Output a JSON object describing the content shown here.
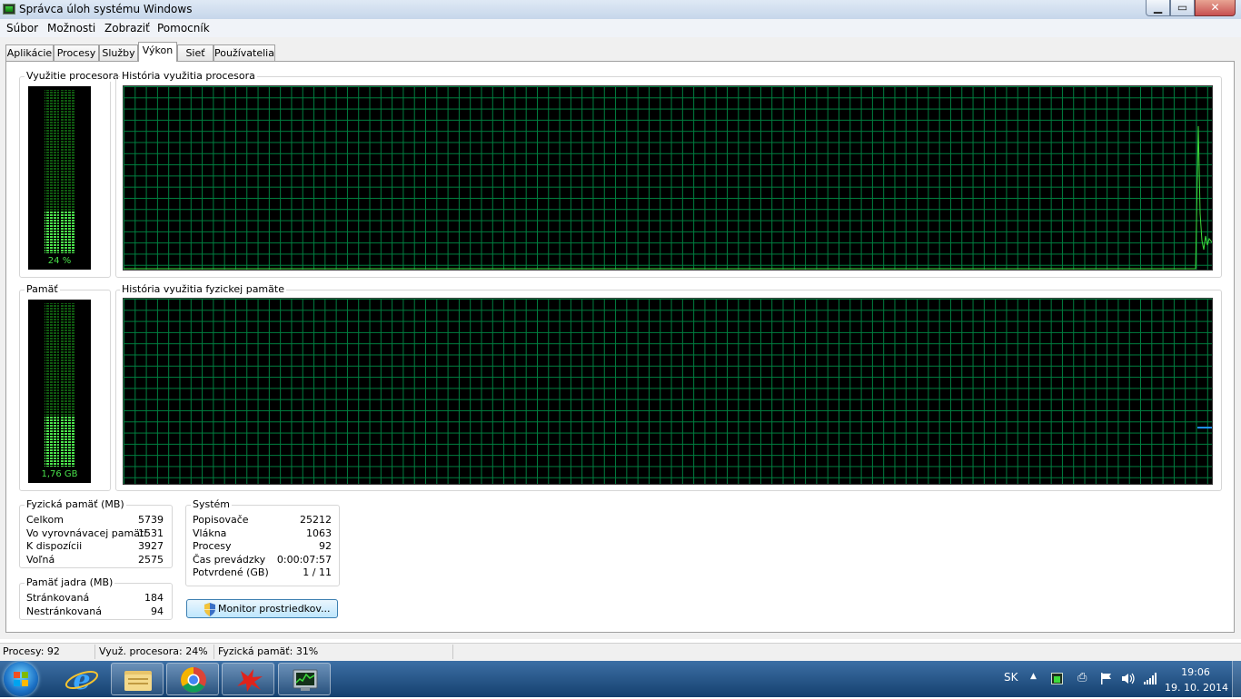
{
  "window": {
    "title": "Správca úloh systému Windows"
  },
  "caption_buttons": {
    "minimize": "▁",
    "maximize": "▭",
    "close": "✕"
  },
  "menu": [
    "Súbor",
    "Možnosti",
    "Zobraziť",
    "Pomocník"
  ],
  "tabs": [
    "Aplikácie",
    "Procesy",
    "Služby",
    "Výkon",
    "Sieť",
    "Používatelia"
  ],
  "active_tab": "Výkon",
  "cpu": {
    "gauge_label": "Využitie procesora",
    "gauge_value": "24 %",
    "history_label": "História využitia procesora"
  },
  "memory": {
    "gauge_label": "Pamäť",
    "gauge_value": "1,76 GB",
    "history_label": "História využitia fyzickej pamäte"
  },
  "physical_memory": {
    "title": "Fyzická pamäť (MB)",
    "rows": [
      {
        "label": "Celkom",
        "value": "5739"
      },
      {
        "label": "Vo vyrovnávacej pamäti",
        "value": "1531"
      },
      {
        "label": "K dispozícii",
        "value": "3927"
      },
      {
        "label": "Voľná",
        "value": "2575"
      }
    ]
  },
  "kernel_memory": {
    "title": "Pamäť jadra (MB)",
    "rows": [
      {
        "label": "Stránkovaná",
        "value": "184"
      },
      {
        "label": "Nestránkovaná",
        "value": "94"
      }
    ]
  },
  "system": {
    "title": "Systém",
    "rows": [
      {
        "label": "Popisovače",
        "value": "25212"
      },
      {
        "label": "Vlákna",
        "value": "1063"
      },
      {
        "label": "Procesy",
        "value": "92"
      },
      {
        "label": "Čas prevádzky",
        "value": "0:00:07:57"
      },
      {
        "label": "Potvrdené (GB)",
        "value": "1 / 11"
      }
    ]
  },
  "resource_monitor_button": "Monitor prostriedkov...",
  "status_bar": [
    "Procesy: 92",
    "Využ. procesora: 24%",
    "Fyzická pamäť: 31%"
  ],
  "taskbar": {
    "apps": [
      "internet-explorer-icon",
      "file-explorer-icon",
      "chrome-icon",
      "red-app-icon",
      "task-manager-icon"
    ],
    "language": "SK",
    "time": "19:06",
    "date": "19. 10. 2014"
  },
  "colors": {
    "graph_grid": "#008040",
    "graph_line": "#3cdc3c",
    "memory_line": "#1e90ff",
    "gauge_text": "#49e04a"
  }
}
